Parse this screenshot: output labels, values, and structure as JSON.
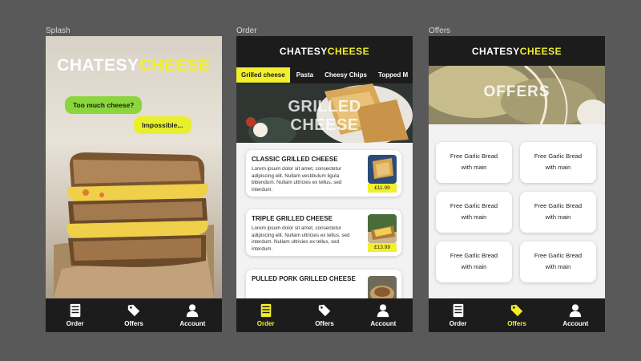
{
  "labels": {
    "splash": "Splash",
    "order": "Order",
    "offers": "Offers"
  },
  "brand": {
    "part1": "CHATESY",
    "part2": "CHEESE"
  },
  "splash": {
    "bubble1": "Too much cheese?",
    "bubble2": "Impossible..."
  },
  "order": {
    "categories": [
      {
        "label": "Grilled cheese",
        "active": true
      },
      {
        "label": "Pasta"
      },
      {
        "label": "Cheesy Chips"
      },
      {
        "label": "Topped M"
      }
    ],
    "hero_title": "GRILLED CHEESE",
    "items": [
      {
        "title": "CLASSIC GRILLED CHEESE",
        "desc": "Lorem ipsum dolor sit amet, consectetur adipiscing elit. Nullam vestibulum ligula bibendum. Nullam ultricies ex tellus, sed interdum.",
        "price": "£11.99"
      },
      {
        "title": "TRIPLE GRILLED CHEESE",
        "desc": "Lorem ipsum dolor sit amet, consectetur adipiscing elit. Nullam ultricies ex tellus, sed interdum. Nullam ultricies ex tellus, sed interdum.",
        "price": "£13.99"
      },
      {
        "title": "PULLED PORK GRILLED CHEESE",
        "desc": "",
        "price": ""
      }
    ]
  },
  "offers": {
    "hero_title": "OFFERS",
    "cards": [
      {
        "line1": "Free Garlic Bread",
        "line2": "with main"
      },
      {
        "line1": "Free Garlic Bread",
        "line2": "with main"
      },
      {
        "line1": "Free Garlic Bread",
        "line2": "with main"
      },
      {
        "line1": "Free Garlic Bread",
        "line2": "with main"
      },
      {
        "line1": "Free Garlic Bread",
        "line2": "with main"
      },
      {
        "line1": "Free Garlic Bread",
        "line2": "with main"
      }
    ]
  },
  "tabbar": [
    {
      "label": "Order",
      "icon": "menu-list-icon"
    },
    {
      "label": "Offers",
      "icon": "price-tag-icon"
    },
    {
      "label": "Account",
      "icon": "user-icon"
    }
  ],
  "colors": {
    "accent": "#f2ef2b",
    "dark": "#1c1c1c",
    "bubble_green": "#8bd63c",
    "background": "#595959"
  }
}
